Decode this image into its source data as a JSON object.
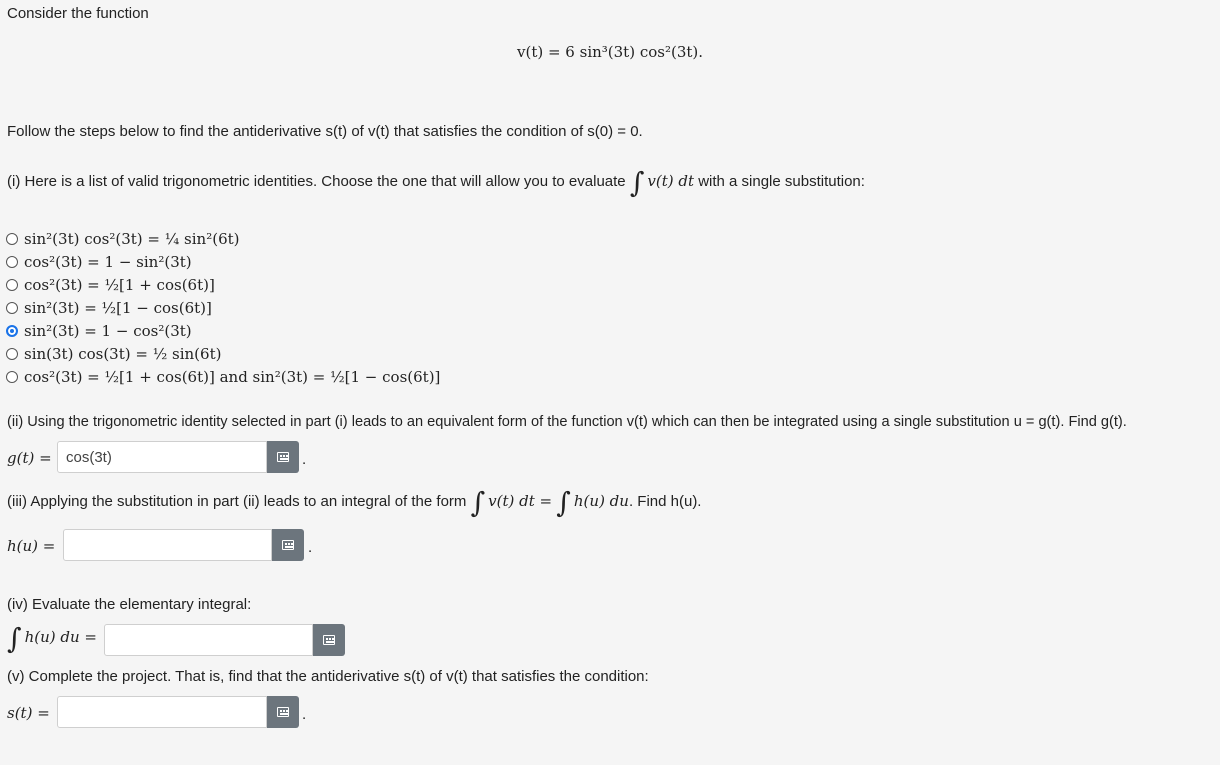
{
  "intro": "Consider the function",
  "function_def": "v(t) = 6 sin³(3t) cos²(3t).",
  "follow": "Follow the steps below to find the antiderivative s(t) of v(t) that satisfies the condition of s(0) = 0.",
  "part1": {
    "prefix": "(i) Here is a list of valid trigonometric identities. Choose the one that will allow you to evaluate",
    "integrand": "v(t) dt",
    "suffix": "with a single substitution:"
  },
  "options": [
    {
      "text": "sin²(3t) cos²(3t) = ¼ sin²(6t)",
      "selected": false
    },
    {
      "text": "cos²(3t) = 1 − sin²(3t)",
      "selected": false
    },
    {
      "text": "cos²(3t) = ½[1 + cos(6t)]",
      "selected": false
    },
    {
      "text": "sin²(3t) = ½[1 − cos(6t)]",
      "selected": false
    },
    {
      "text": "sin²(3t) = 1 − cos²(3t)",
      "selected": true
    },
    {
      "text": "sin(3t) cos(3t) = ½ sin(6t)",
      "selected": false
    },
    {
      "text": "cos²(3t) = ½[1 + cos(6t)] and sin²(3t) = ½[1 − cos(6t)]",
      "selected": false
    }
  ],
  "part2": {
    "text": "(ii) Using the trigonometric identity selected in part (i) leads to an equivalent form of the function v(t) which can then be integrated using a single substitution u = g(t). Find g(t).",
    "label": "g(t) =",
    "value": "cos(3t)"
  },
  "part3": {
    "prefix": "(iii) Applying the substitution in part (ii) leads to an integral of the form",
    "formula": "v(t) dt =",
    "formula2": "h(u) du",
    "suffix": ". Find h(u).",
    "label": "h(u) =",
    "value": ""
  },
  "part4": {
    "text": "(iv) Evaluate the elementary integral:",
    "label": "h(u) du =",
    "value": ""
  },
  "part5": {
    "text": "(v) Complete the project. That is, find that the antiderivative s(t) of v(t) that satisfies the condition:",
    "label": "s(t) =",
    "value": ""
  },
  "colors": {
    "selected_radio": "#1a73e8",
    "keyboard_button": "#6c757d",
    "background": "#f5f5f5"
  },
  "icons": {
    "keyboard": "keyboard-icon"
  }
}
